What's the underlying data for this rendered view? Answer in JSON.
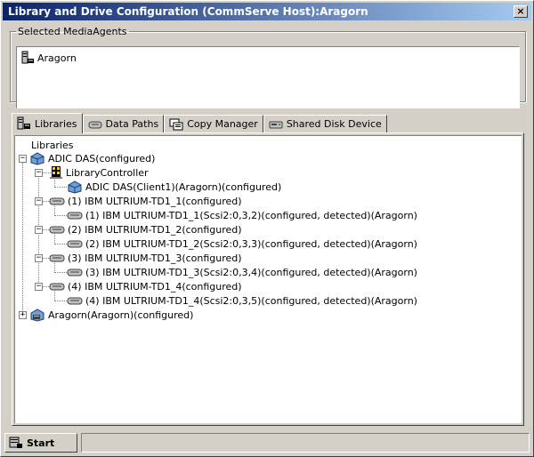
{
  "window": {
    "title": "Library and Drive Configuration (CommServe Host):Aragorn",
    "close_label": "×"
  },
  "mediaagents": {
    "group_label": "Selected MediaAgents",
    "items": [
      "Aragorn"
    ]
  },
  "tabs": [
    {
      "label": "Libraries",
      "icon": "library-icon",
      "active": true
    },
    {
      "label": "Data Paths",
      "icon": "tape-icon",
      "active": false
    },
    {
      "label": "Copy Manager",
      "icon": "copy-manager-icon",
      "active": false
    },
    {
      "label": "Shared Disk Device",
      "icon": "disk-icon",
      "active": false
    }
  ],
  "tree": {
    "root": "Libraries",
    "library": "ADIC DAS(configured)",
    "controller": "LibraryController",
    "controller_child": "ADIC DAS(Client1)(Aragorn)(configured)",
    "drives": [
      {
        "label": "(1) IBM ULTRIUM-TD1_1(configured)",
        "child": "(1) IBM ULTRIUM-TD1_1(Scsi2:0,3,2)(configured, detected)(Aragorn)"
      },
      {
        "label": "(2) IBM ULTRIUM-TD1_2(configured)",
        "child": "(2) IBM ULTRIUM-TD1_2(Scsi2:0,3,3)(configured, detected)(Aragorn)"
      },
      {
        "label": "(3) IBM ULTRIUM-TD1_3(configured)",
        "child": "(3) IBM ULTRIUM-TD1_3(Scsi2:0,3,4)(configured, detected)(Aragorn)"
      },
      {
        "label": "(4) IBM ULTRIUM-TD1_4(configured)",
        "child": "(4) IBM ULTRIUM-TD1_4(Scsi2:0,3,5)(configured, detected)(Aragorn)"
      }
    ],
    "second_library": "Aragorn(Aragorn)(configured)",
    "expander_minus": "−",
    "expander_plus": "+"
  },
  "statusbar": {
    "start_label": "Start",
    "status_text": ""
  }
}
